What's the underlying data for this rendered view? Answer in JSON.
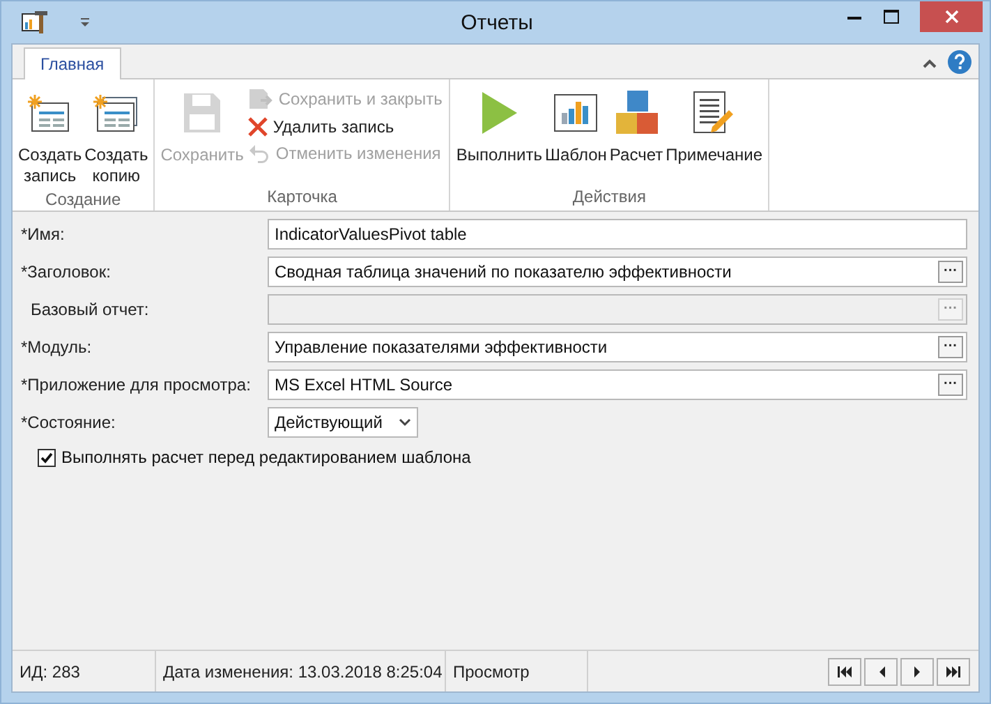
{
  "window": {
    "title": "Отчеты"
  },
  "tabs": [
    {
      "label": "Главная",
      "selected": true
    }
  ],
  "ribbon": [
    {
      "label": "Создание",
      "buttons": [
        {
          "kind": "large",
          "label": "Создать\nзапись",
          "disabled": false
        },
        {
          "kind": "large",
          "label": "Создать\nкопию",
          "disabled": false
        }
      ]
    },
    {
      "label": "Карточка",
      "buttons": [
        {
          "kind": "large",
          "label": "Сохранить",
          "disabled": true
        },
        {
          "kind": "small",
          "label": "Сохранить и закрыть",
          "disabled": true
        },
        {
          "kind": "small",
          "label": "Удалить запись",
          "disabled": false
        },
        {
          "kind": "small",
          "label": "Отменить изменения",
          "disabled": true
        }
      ]
    },
    {
      "label": "Действия",
      "buttons": [
        {
          "kind": "large",
          "label": "Выполнить",
          "disabled": false
        },
        {
          "kind": "large",
          "label": "Шаблон",
          "disabled": false
        },
        {
          "kind": "large",
          "label": "Расчет",
          "disabled": false
        },
        {
          "kind": "large",
          "label": "Примечание",
          "disabled": false
        }
      ]
    }
  ],
  "fields": [
    {
      "kind": "text",
      "label": "*Имя:",
      "value": "IndicatorValuesPivot table",
      "disabled": false
    },
    {
      "kind": "lookup",
      "label": "*Заголовок:",
      "value": "Сводная таблица значений по показателю эффективности",
      "disabled": false
    },
    {
      "kind": "lookup",
      "label": "Базовый отчет:",
      "disabled": true
    },
    {
      "kind": "lookup",
      "label": "*Модуль:",
      "value": "Управление показателями эффективности",
      "disabled": false
    },
    {
      "kind": "lookup",
      "label": "*Приложение для просмотра:",
      "value": "MS Excel HTML Source",
      "disabled": false
    },
    {
      "kind": "select",
      "label": "*Состояние:",
      "value": "Действующий",
      "disabled": false
    }
  ],
  "lookup_button": "···",
  "checkbox": {
    "label": "Выполнять расчет перед редактированием шаблона",
    "checked": true
  },
  "status_bar": [
    "ИД: 283",
    "Дата изменения: 13.03.2018 8:25:04",
    "Просмотр"
  ]
}
